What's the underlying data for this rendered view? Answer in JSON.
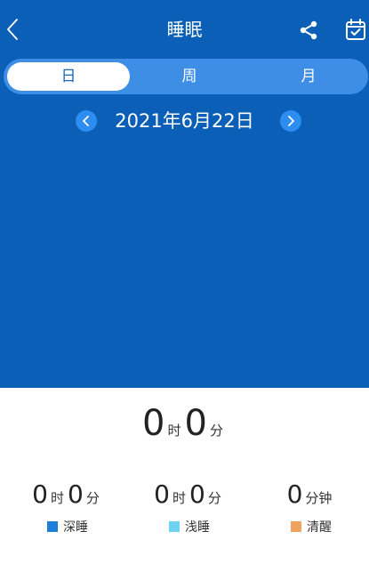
{
  "header": {
    "title": "睡眠",
    "back_icon": "chevron-left-icon",
    "share_icon": "share-icon",
    "calendar_icon": "calendar-check-icon"
  },
  "tabs": [
    {
      "label": "日",
      "active": true
    },
    {
      "label": "周",
      "active": false
    },
    {
      "label": "月",
      "active": false
    }
  ],
  "date": {
    "text": "2021年6月22日"
  },
  "summary": {
    "hours": "0",
    "hours_unit": "时",
    "minutes": "0",
    "minutes_unit": "分"
  },
  "stats": [
    {
      "hours": "0",
      "hours_unit": "时",
      "minutes": "0",
      "minutes_unit": "分",
      "label": "深睡",
      "color": "#1f7fd8"
    },
    {
      "hours": "0",
      "hours_unit": "时",
      "minutes": "0",
      "minutes_unit": "分",
      "label": "浅睡",
      "color": "#6fd3f2"
    },
    {
      "minutes": "0",
      "minutes_unit": "分钟",
      "label": "清醒",
      "color": "#f0a35e"
    }
  ],
  "colors": {
    "header_bg": "#0b5fb6",
    "segment_bg": "#3e8ee6",
    "nav_circle": "#2e8df0",
    "accent_text": "#1766c3"
  }
}
